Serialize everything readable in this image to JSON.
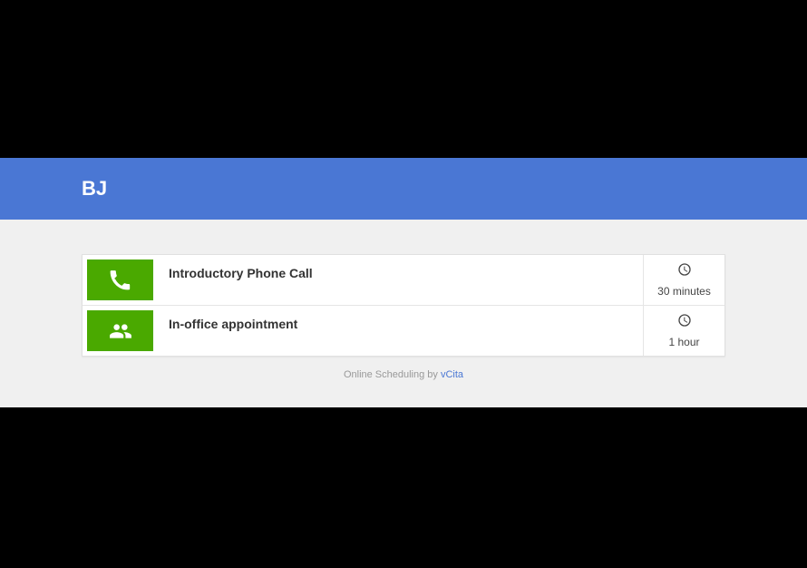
{
  "header": {
    "title": "BJ"
  },
  "services": [
    {
      "icon": "phone-icon",
      "title": "Introductory Phone Call",
      "duration": "30 minutes"
    },
    {
      "icon": "people-icon",
      "title": "In-office appointment",
      "duration": "1 hour"
    }
  ],
  "footer": {
    "prefix": "Online Scheduling by ",
    "link": "vCita"
  }
}
